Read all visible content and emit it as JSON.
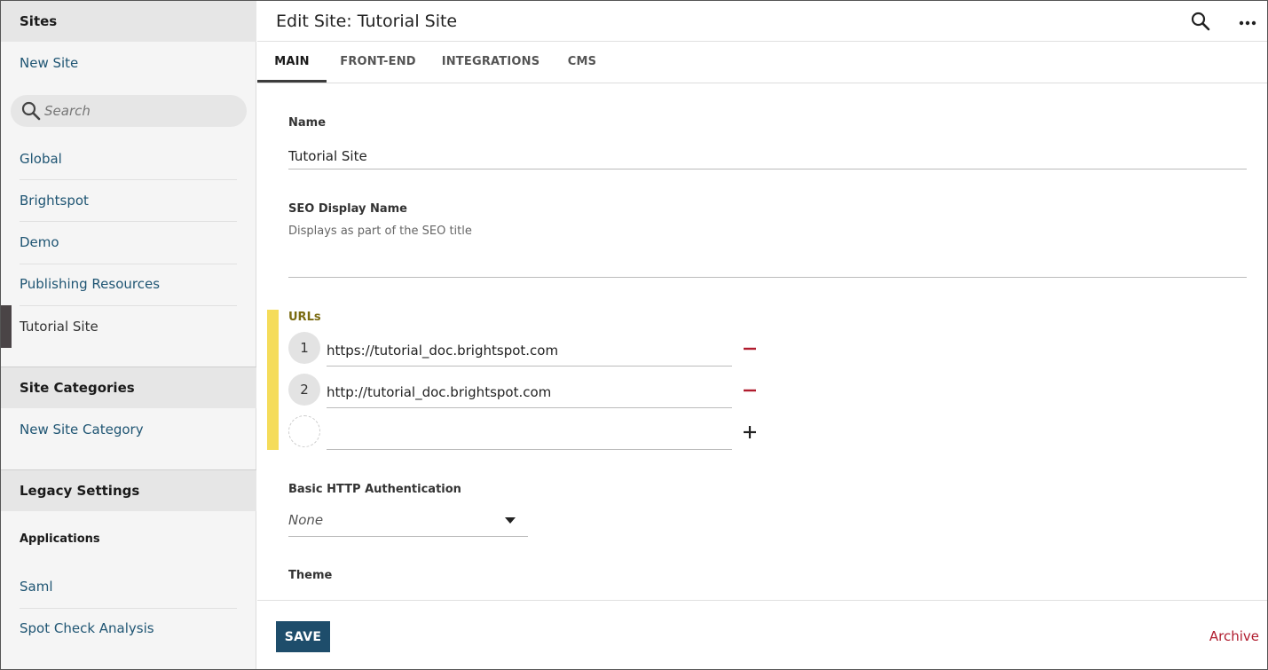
{
  "sidebar": {
    "sites_header": "Sites",
    "new_site": "New Site",
    "search_placeholder": "Search",
    "sites": [
      "Global",
      "Brightspot",
      "Demo",
      "Publishing Resources",
      "Tutorial Site"
    ],
    "active_site": "Tutorial Site",
    "categories_header": "Site Categories",
    "new_category": "New Site Category",
    "legacy_header": "Legacy Settings",
    "applications_label": "Applications",
    "applications": [
      "Saml",
      "Spot Check Analysis"
    ]
  },
  "header": {
    "title": "Edit Site: Tutorial Site",
    "search_icon": "search-icon",
    "more_icon": "more-horizontal-icon"
  },
  "tabs": [
    {
      "label": "MAIN",
      "active": true
    },
    {
      "label": "FRONT-END",
      "active": false
    },
    {
      "label": "INTEGRATIONS",
      "active": false
    },
    {
      "label": "CMS",
      "active": false
    }
  ],
  "form": {
    "name_label": "Name",
    "name_value": "Tutorial Site",
    "seo_label": "SEO Display Name",
    "seo_help": "Displays as part of the SEO title",
    "seo_value": "",
    "urls_label": "URLs",
    "urls": [
      {
        "index": "1",
        "value": "https://tutorial_doc.brightspot.com"
      },
      {
        "index": "2",
        "value": "http://tutorial_doc.brightspot.com"
      }
    ],
    "new_url_value": "",
    "auth_label": "Basic HTTP Authentication",
    "auth_value": "None",
    "theme_label": "Theme"
  },
  "footer": {
    "save_label": "SAVE",
    "archive_label": "Archive"
  },
  "colors": {
    "accent": "#1e4d6b",
    "link": "#1f5573",
    "danger": "#b01c2e",
    "urls_marker": "#f5dc5a"
  }
}
